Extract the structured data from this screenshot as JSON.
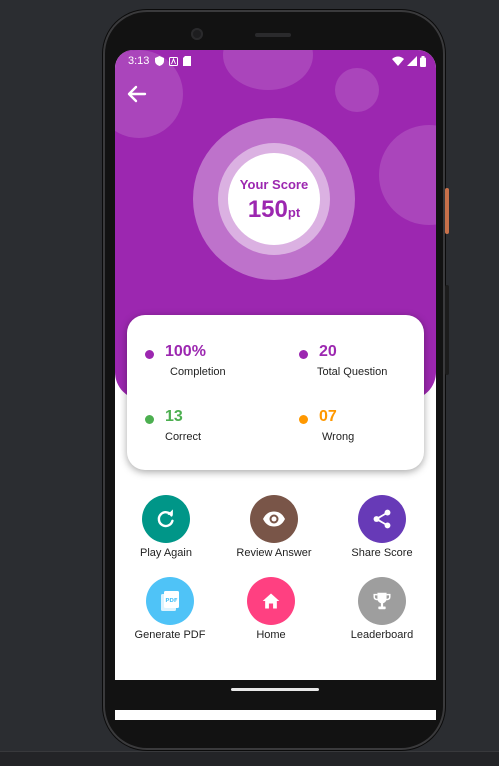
{
  "status_bar": {
    "time": "3:13"
  },
  "score": {
    "title": "Your Score",
    "value": "150",
    "unit": "pt"
  },
  "stats": [
    {
      "value": "100%",
      "label": "Completion",
      "color": "#9c27b0"
    },
    {
      "value": "20",
      "label": "Total Question",
      "color": "#9c27b0"
    },
    {
      "value": "13",
      "label": "Correct",
      "color": "#4caf50"
    },
    {
      "value": "07",
      "label": "Wrong",
      "color": "#ff9800"
    }
  ],
  "actions": [
    {
      "label": "Play Again",
      "icon": "refresh-icon",
      "color": "#009688"
    },
    {
      "label": "Review Answer",
      "icon": "eye-icon",
      "color": "#795548"
    },
    {
      "label": "Share Score",
      "icon": "share-icon",
      "color": "#673ab7"
    },
    {
      "label": "Generate PDF",
      "icon": "pdf-icon",
      "color": "#4fc3f7"
    },
    {
      "label": "Home",
      "icon": "home-icon",
      "color": "#ff4081"
    },
    {
      "label": "Leaderboard",
      "icon": "trophy-icon",
      "color": "#9e9e9e"
    }
  ],
  "colors": {
    "primary": "#9c27b0",
    "app_background": "#2b2d31"
  }
}
